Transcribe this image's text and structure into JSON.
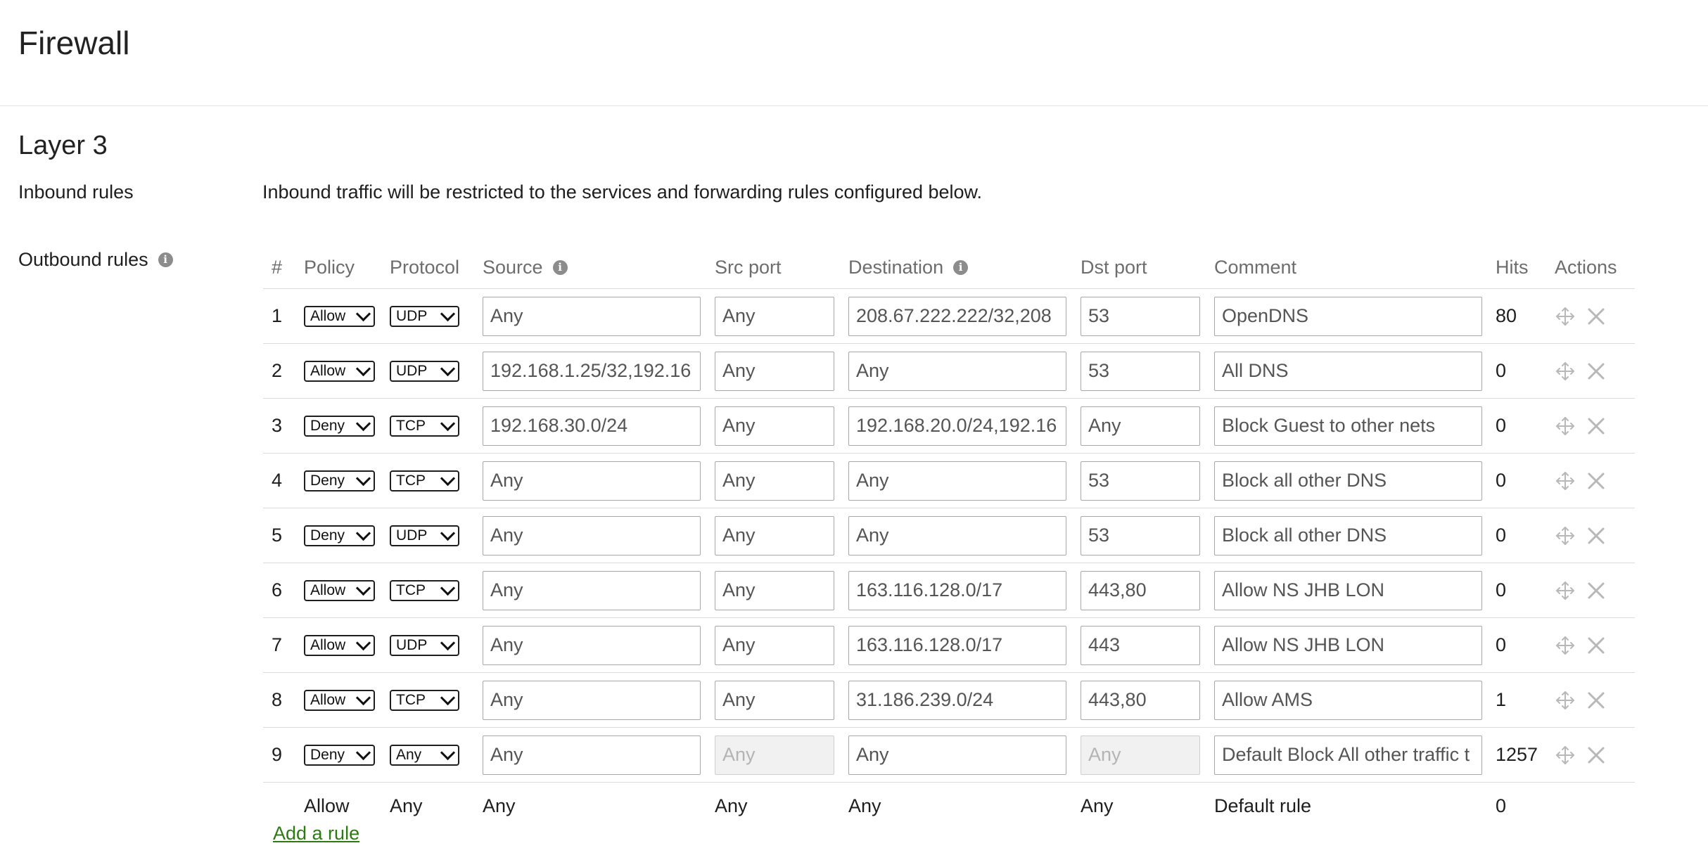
{
  "page": {
    "title": "Firewall",
    "section_title": "Layer 3",
    "inbound_label": "Inbound rules",
    "inbound_description": "Inbound traffic will be restricted to the services and forwarding rules configured below.",
    "outbound_label": "Outbound rules",
    "info_glyph": "i"
  },
  "table": {
    "headers": {
      "num": "#",
      "policy": "Policy",
      "protocol": "Protocol",
      "source": "Source",
      "src_port": "Src port",
      "destination": "Destination",
      "dst_port": "Dst port",
      "comment": "Comment",
      "hits": "Hits",
      "actions": "Actions"
    },
    "rows": [
      {
        "num": "1",
        "policy": "Allow",
        "protocol": "UDP",
        "source": "Any",
        "src_port": "Any",
        "destination": "208.67.222.222/32,208",
        "dst_port": "53",
        "comment": "OpenDNS",
        "hits": "80",
        "src_port_disabled": false,
        "dst_port_disabled": false
      },
      {
        "num": "2",
        "policy": "Allow",
        "protocol": "UDP",
        "source": "192.168.1.25/32,192.16",
        "src_port": "Any",
        "destination": "Any",
        "dst_port": "53",
        "comment": "All DNS",
        "hits": "0",
        "src_port_disabled": false,
        "dst_port_disabled": false
      },
      {
        "num": "3",
        "policy": "Deny",
        "protocol": "TCP",
        "source": "192.168.30.0/24",
        "src_port": "Any",
        "destination": "192.168.20.0/24,192.16",
        "dst_port": "Any",
        "comment": "Block Guest to other nets",
        "hits": "0",
        "src_port_disabled": false,
        "dst_port_disabled": false
      },
      {
        "num": "4",
        "policy": "Deny",
        "protocol": "TCP",
        "source": "Any",
        "src_port": "Any",
        "destination": "Any",
        "dst_port": "53",
        "comment": "Block all other DNS",
        "hits": "0",
        "src_port_disabled": false,
        "dst_port_disabled": false
      },
      {
        "num": "5",
        "policy": "Deny",
        "protocol": "UDP",
        "source": "Any",
        "src_port": "Any",
        "destination": "Any",
        "dst_port": "53",
        "comment": "Block all other DNS",
        "hits": "0",
        "src_port_disabled": false,
        "dst_port_disabled": false
      },
      {
        "num": "6",
        "policy": "Allow",
        "protocol": "TCP",
        "source": "Any",
        "src_port": "Any",
        "destination": "163.116.128.0/17",
        "dst_port": "443,80",
        "comment": "Allow NS JHB LON",
        "hits": "0",
        "src_port_disabled": false,
        "dst_port_disabled": false
      },
      {
        "num": "7",
        "policy": "Allow",
        "protocol": "UDP",
        "source": "Any",
        "src_port": "Any",
        "destination": "163.116.128.0/17",
        "dst_port": "443",
        "comment": "Allow NS JHB LON",
        "hits": "0",
        "src_port_disabled": false,
        "dst_port_disabled": false
      },
      {
        "num": "8",
        "policy": "Allow",
        "protocol": "TCP",
        "source": "Any",
        "src_port": "Any",
        "destination": "31.186.239.0/24",
        "dst_port": "443,80",
        "comment": "Allow AMS",
        "hits": "1",
        "src_port_disabled": false,
        "dst_port_disabled": false
      },
      {
        "num": "9",
        "policy": "Deny",
        "protocol": "Any",
        "source": "Any",
        "src_port": "Any",
        "destination": "Any",
        "dst_port": "Any",
        "comment": "Default Block All other traffic t",
        "hits": "1257",
        "src_port_disabled": true,
        "dst_port_disabled": true
      }
    ],
    "default_rule": {
      "policy": "Allow",
      "protocol": "Any",
      "source": "Any",
      "src_port": "Any",
      "destination": "Any",
      "dst_port": "Any",
      "comment": "Default rule",
      "hits": "0"
    },
    "add_rule_label": "Add a rule",
    "row_action_icons": [
      "move-icon",
      "close-icon"
    ]
  },
  "colors": {
    "link": "#2d7a12",
    "header_text": "#6d6d6d",
    "disabled_bg": "#f1f1f1",
    "icon_gray": "#b8b8b8"
  }
}
